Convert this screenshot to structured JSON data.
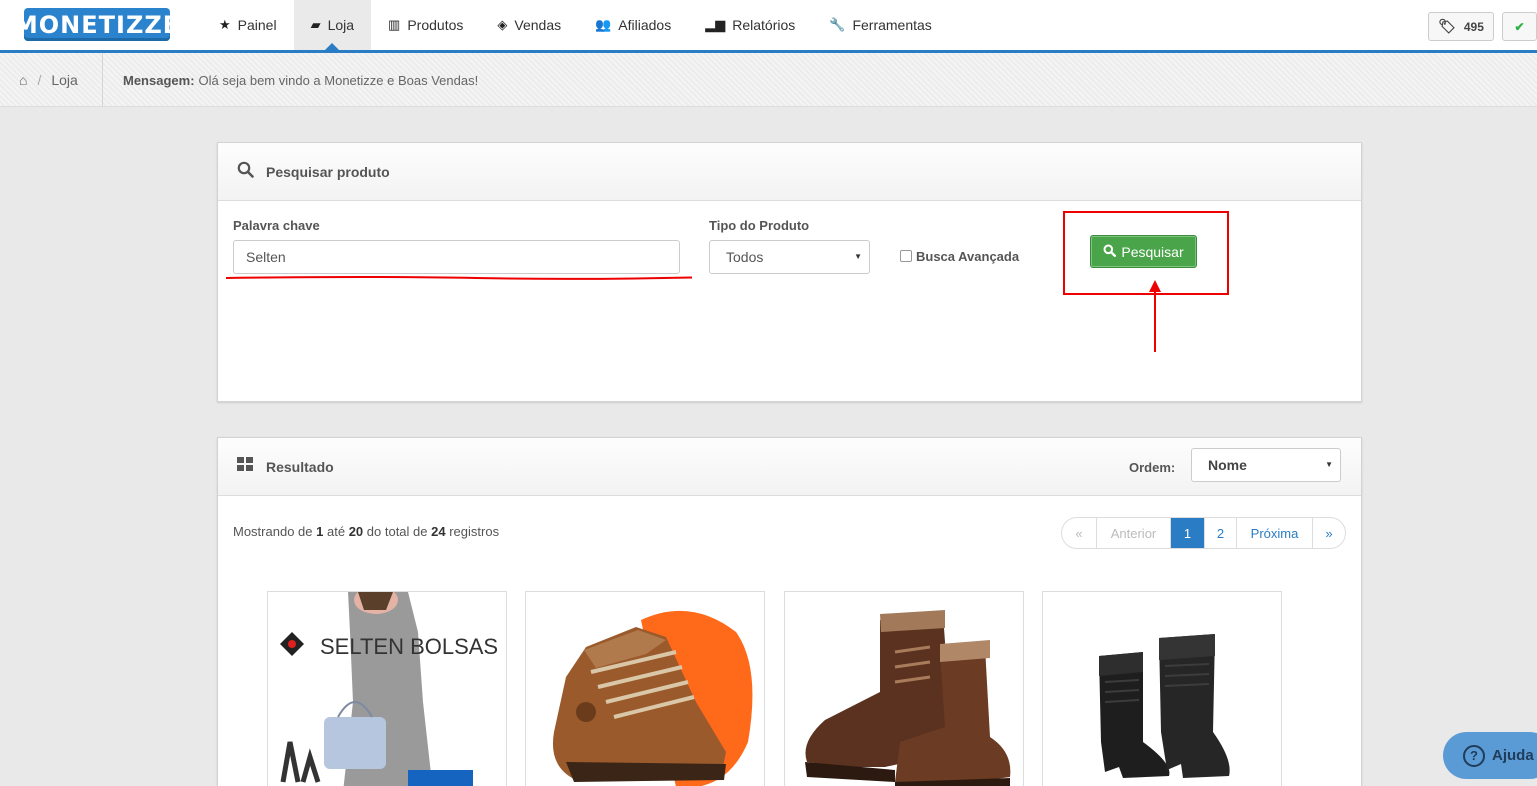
{
  "brand": {
    "logo_text": "MONETIZZE",
    "accent": "#2a7dc4",
    "green": "#4aa54a",
    "annotation_red": "#e00000"
  },
  "nav": {
    "items": [
      {
        "label": "Painel",
        "icon": "star-icon"
      },
      {
        "label": "Loja",
        "icon": "shopping-bag-icon"
      },
      {
        "label": "Produtos",
        "icon": "barcode-icon"
      },
      {
        "label": "Vendas",
        "icon": "money-icon"
      },
      {
        "label": "Afiliados",
        "icon": "users-icon"
      },
      {
        "label": "Relatórios",
        "icon": "bar-chart-icon"
      },
      {
        "label": "Ferramentas",
        "icon": "wrench-icon"
      }
    ],
    "active": "Loja",
    "tag_count": "495"
  },
  "breadcrumb": {
    "current": "Loja"
  },
  "message": {
    "label": "Mensagem:",
    "text": "Olá seja bem vindo a Monetizze e Boas Vendas!"
  },
  "search": {
    "title": "Pesquisar produto",
    "keyword_label": "Palavra chave",
    "keyword_value": "Selten",
    "type_label": "Tipo do Produto",
    "type_value": "Todos",
    "advanced_label": "Busca Avançada",
    "advanced_checked": false,
    "button_label": "Pesquisar"
  },
  "results": {
    "title": "Resultado",
    "order_label": "Ordem:",
    "order_value": "Nome",
    "showing_prefix": "Mostrando de",
    "from": "1",
    "to_prefix": "até",
    "to": "20",
    "total_prefix": "do total de",
    "total": "24",
    "suffix": "registros",
    "pager": {
      "first": "«",
      "prev": "Anterior",
      "pages": [
        "1",
        "2"
      ],
      "current": "1",
      "next": "Próxima",
      "last": "»"
    },
    "products": [
      {
        "image": "handbag-model-photo",
        "brand_text": "SELTEN BOLSAS"
      },
      {
        "image": "brown-work-boot-orange-sole"
      },
      {
        "image": "brown-leather-boots-pair"
      },
      {
        "image": "black-tall-boots"
      }
    ]
  },
  "help": {
    "label": "Ajuda"
  }
}
